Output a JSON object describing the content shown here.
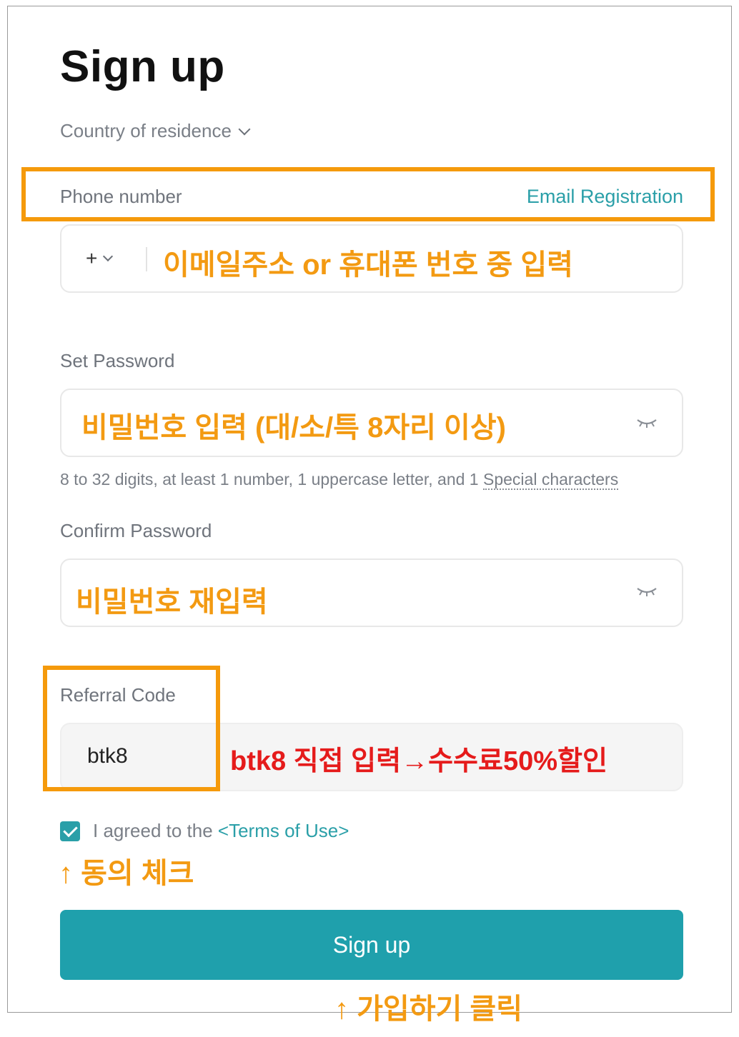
{
  "header": {
    "title": "Sign up"
  },
  "country": {
    "label": "Country of residence"
  },
  "phone": {
    "label": "Phone number",
    "email_link": "Email Registration",
    "prefix": "+",
    "annotation": "이메일주소 or 휴대폰 번호 중 입력"
  },
  "password": {
    "label": "Set Password",
    "annotation": "비밀번호 입력 (대/소/특 8자리 이상)",
    "hint_main": "8 to 32 digits, at least 1 number, 1 uppercase letter, and 1 ",
    "hint_special": "Special characters"
  },
  "confirm": {
    "label": "Confirm Password",
    "annotation": "비밀번호 재입력"
  },
  "referral": {
    "label": "Referral Code",
    "value": "btk8",
    "annotation": "btk8 직접 입력→수수료50%할인"
  },
  "terms": {
    "text": "I agreed to the ",
    "link": "<Terms of Use>",
    "annotation": "↑ 동의 체크"
  },
  "submit": {
    "label": "Sign up",
    "annotation": "↑ 가입하기 클릭"
  },
  "colors": {
    "accent": "#1fa0ac",
    "link": "#2a9fa8",
    "annotation_orange": "#f39a12",
    "annotation_red": "#e51b1b"
  },
  "icons": [
    "chevron-down-icon",
    "eye-closed-icon",
    "checkbox-checked-icon"
  ]
}
